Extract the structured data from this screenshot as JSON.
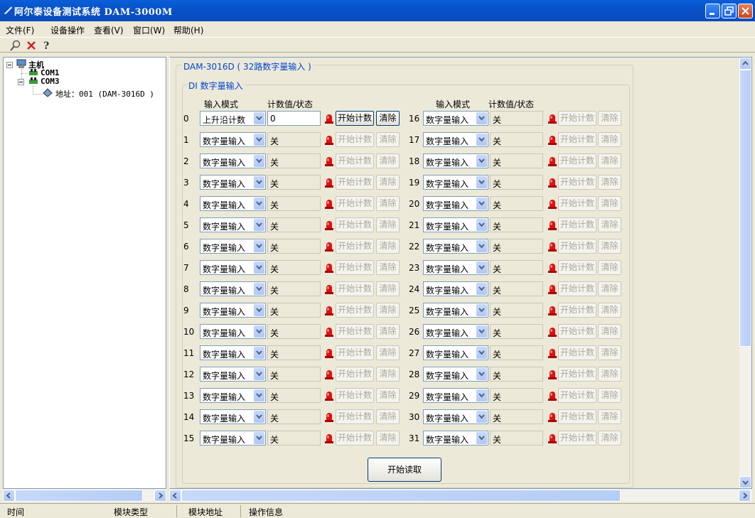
{
  "window": {
    "title": "阿尔泰设备测试系统 DAM-3000M",
    "controls": [
      "minimize",
      "maximize",
      "close"
    ]
  },
  "menu": {
    "items": [
      "文件(F)",
      "设备操作",
      "查看(V)",
      "窗口(W)",
      "帮助(H)"
    ]
  },
  "toolbar": {
    "icons": [
      "search-icon",
      "delete-icon",
      "help-icon"
    ]
  },
  "tree": {
    "root": "主机",
    "com1": "COM1",
    "com3": "COM3",
    "device": "地址：001 (DAM-3016D )"
  },
  "panel": {
    "group_title": "DAM-3016D ( 32路数字量输入 )",
    "subgroup_title": "DI 数字量输入",
    "header_mode": "输入模式",
    "header_count": "计数值/状态",
    "start_count_label": "开始计数",
    "clear_label": "清除",
    "read_button": "开始读取"
  },
  "channels_left": [
    {
      "index": "0",
      "mode": "上升沿计数",
      "value": "0",
      "enabled": true
    },
    {
      "index": "1",
      "mode": "数字量输入",
      "value": "关",
      "enabled": false
    },
    {
      "index": "2",
      "mode": "数字量输入",
      "value": "关",
      "enabled": false
    },
    {
      "index": "3",
      "mode": "数字量输入",
      "value": "关",
      "enabled": false
    },
    {
      "index": "4",
      "mode": "数字量输入",
      "value": "关",
      "enabled": false
    },
    {
      "index": "5",
      "mode": "数字量输入",
      "value": "关",
      "enabled": false
    },
    {
      "index": "6",
      "mode": "数字量输入",
      "value": "关",
      "enabled": false
    },
    {
      "index": "7",
      "mode": "数字量输入",
      "value": "关",
      "enabled": false
    },
    {
      "index": "8",
      "mode": "数字量输入",
      "value": "关",
      "enabled": false
    },
    {
      "index": "9",
      "mode": "数字量输入",
      "value": "关",
      "enabled": false
    },
    {
      "index": "10",
      "mode": "数字量输入",
      "value": "关",
      "enabled": false
    },
    {
      "index": "11",
      "mode": "数字量输入",
      "value": "关",
      "enabled": false
    },
    {
      "index": "12",
      "mode": "数字量输入",
      "value": "关",
      "enabled": false
    },
    {
      "index": "13",
      "mode": "数字量输入",
      "value": "关",
      "enabled": false
    },
    {
      "index": "14",
      "mode": "数字量输入",
      "value": "关",
      "enabled": false
    },
    {
      "index": "15",
      "mode": "数字量输入",
      "value": "关",
      "enabled": false
    }
  ],
  "channels_right": [
    {
      "index": "16",
      "mode": "数字量输入",
      "value": "关",
      "enabled": false
    },
    {
      "index": "17",
      "mode": "数字量输入",
      "value": "关",
      "enabled": false
    },
    {
      "index": "18",
      "mode": "数字量输入",
      "value": "关",
      "enabled": false
    },
    {
      "index": "19",
      "mode": "数字量输入",
      "value": "关",
      "enabled": false
    },
    {
      "index": "20",
      "mode": "数字量输入",
      "value": "关",
      "enabled": false
    },
    {
      "index": "21",
      "mode": "数字量输入",
      "value": "关",
      "enabled": false
    },
    {
      "index": "22",
      "mode": "数字量输入",
      "value": "关",
      "enabled": false
    },
    {
      "index": "23",
      "mode": "数字量输入",
      "value": "关",
      "enabled": false
    },
    {
      "index": "24",
      "mode": "数字量输入",
      "value": "关",
      "enabled": false
    },
    {
      "index": "25",
      "mode": "数字量输入",
      "value": "关",
      "enabled": false
    },
    {
      "index": "26",
      "mode": "数字量输入",
      "value": "关",
      "enabled": false
    },
    {
      "index": "27",
      "mode": "数字量输入",
      "value": "关",
      "enabled": false
    },
    {
      "index": "28",
      "mode": "数字量输入",
      "value": "关",
      "enabled": false
    },
    {
      "index": "29",
      "mode": "数字量输入",
      "value": "关",
      "enabled": false
    },
    {
      "index": "30",
      "mode": "数字量输入",
      "value": "关",
      "enabled": false
    },
    {
      "index": "31",
      "mode": "数字量输入",
      "value": "关",
      "enabled": false
    }
  ],
  "statusbar": {
    "columns": [
      "时间",
      "模块类型",
      "模块地址",
      "操作信息"
    ]
  },
  "colors": {
    "titlebar": "#0a5fd8",
    "group_caption": "#0046d5",
    "led_red": "#e01010",
    "face": "#ece9d8"
  }
}
